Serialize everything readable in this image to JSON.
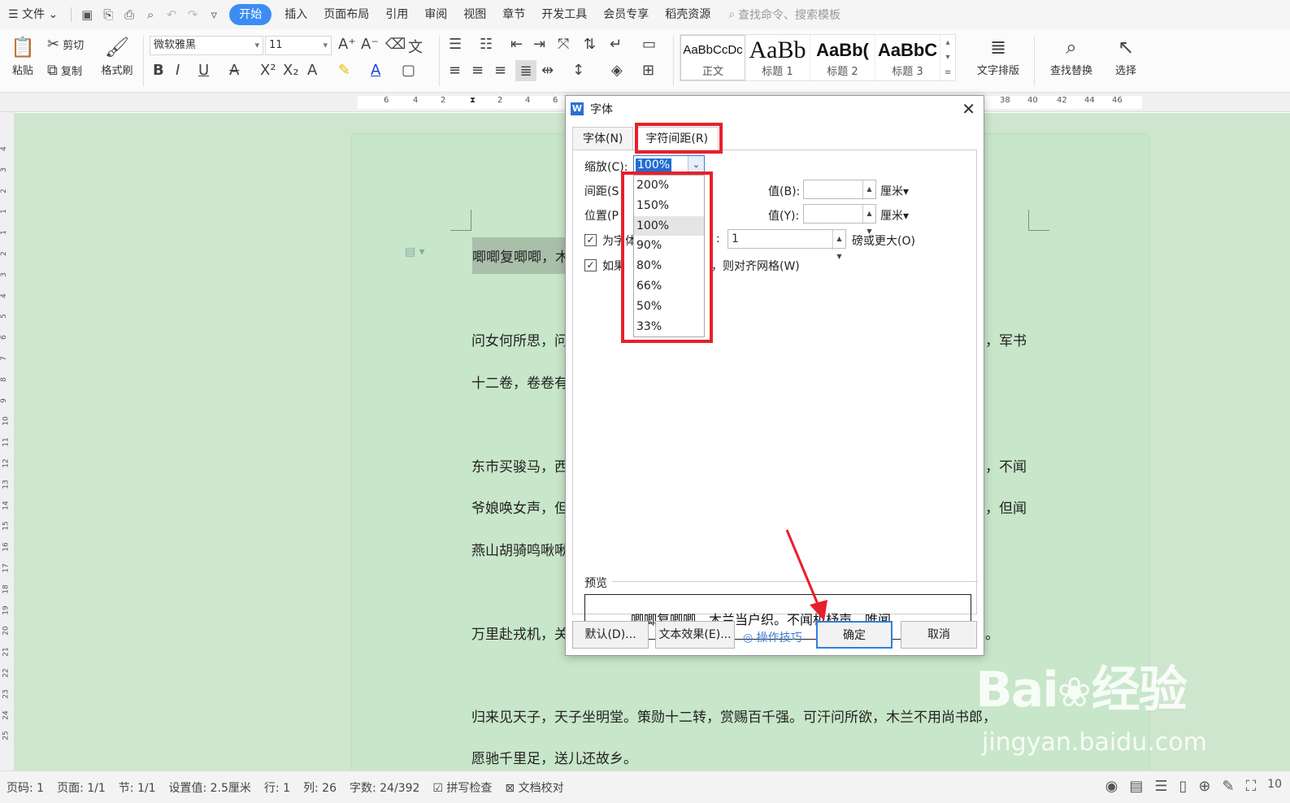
{
  "menubar": {
    "file": "文件",
    "tabs": [
      "开始",
      "插入",
      "页面布局",
      "引用",
      "审阅",
      "视图",
      "章节",
      "开发工具",
      "会员专享",
      "稻壳资源"
    ],
    "search_placeholder": "查找命令、搜索模板"
  },
  "ribbon": {
    "paste": "粘贴",
    "cut": "剪切",
    "copy": "复制",
    "format_painter": "格式刷",
    "font_name": "微软雅黑",
    "font_size": "11",
    "styles": [
      {
        "sample": "AaBbCcDc",
        "name": "正文"
      },
      {
        "sample": "AaBb",
        "name": "标题 1"
      },
      {
        "sample": "AaBb(",
        "name": "标题 2"
      },
      {
        "sample": "AaBbC",
        "name": "标题 3"
      }
    ],
    "text_layout": "文字排版",
    "find_replace": "查找替换",
    "select": "选择"
  },
  "ruler": {
    "top": [
      "6",
      "4",
      "2",
      "2",
      "4",
      "6",
      "38",
      "40",
      "42",
      "44",
      "46"
    ],
    "left": [
      "4",
      "3",
      "2",
      "1",
      "1",
      "2",
      "3",
      "4",
      "5",
      "6",
      "7",
      "8",
      "9",
      "10",
      "11",
      "12",
      "13",
      "14",
      "15",
      "16",
      "17",
      "18",
      "19",
      "20",
      "21",
      "22",
      "23",
      "24",
      "25"
    ]
  },
  "document": {
    "lines": [
      {
        "left": "唧唧复唧唧，木",
        "right": ""
      },
      {
        "left": "问女何所思，问",
        "right": "，军书"
      },
      {
        "left": "十二卷，卷卷有",
        "right": ""
      },
      {
        "left": "东市买骏马，西",
        "right": "，不闻"
      },
      {
        "left": "爷娘唤女声，但",
        "right": "，但闻"
      },
      {
        "left": "燕山胡骑鸣啾啾",
        "right": ""
      },
      {
        "left": "万里赴戎机，关",
        "right": "。"
      },
      {
        "left": "归来见天子，天子坐明堂。策勋十二转，赏赐百千强。可汗问所欲，木兰不用尚书郎，",
        "right": ""
      },
      {
        "left": "愿驰千里足，送儿还故乡。",
        "right": ""
      }
    ]
  },
  "dialog": {
    "title": "字体",
    "tab_font": "字体(N)",
    "tab_spacing": "字符间距(R)",
    "scale_label": "缩放(C):",
    "scale_value": "100%",
    "spacing_label": "间距(S",
    "position_label": "位置(P",
    "value_b_label": "值(B):",
    "value_y_label": "值(Y):",
    "unit_cm": "厘米",
    "kerning_label": "为字体",
    "kerning_suffix": ":",
    "kerning_value": "1",
    "kerning_unit": "磅或更大(O)",
    "grid_label": "如果",
    "grid_suffix": "，则对齐网格(W)",
    "scale_options": [
      "200%",
      "150%",
      "100%",
      "90%",
      "80%",
      "66%",
      "50%",
      "33%"
    ],
    "scale_selected": "100%",
    "preview_label": "预览",
    "preview_text": "唧唧复唧唧，木兰当户织。不闻机杼声，唯闻",
    "default_button": "默认(D)...",
    "text_effect_button": "文本效果(E)...",
    "tips": "操作技巧",
    "ok_button": "确定",
    "cancel_button": "取消"
  },
  "statusbar": {
    "items": [
      "页码: 1",
      "页面: 1/1",
      "节: 1/1",
      "设置值: 2.5厘米",
      "行: 1",
      "列: 26",
      "字数: 24/392",
      "拼写检查",
      "文档校对"
    ],
    "zoom_icon_text": "10"
  },
  "watermark": {
    "brand": "Bai",
    "brand_cn": "经验",
    "url": "jingyan.baidu.com"
  },
  "colors": {
    "accent": "#3d8cf5",
    "highlight_red": "#e8202a",
    "doc_bg": "#c8e6c9"
  }
}
